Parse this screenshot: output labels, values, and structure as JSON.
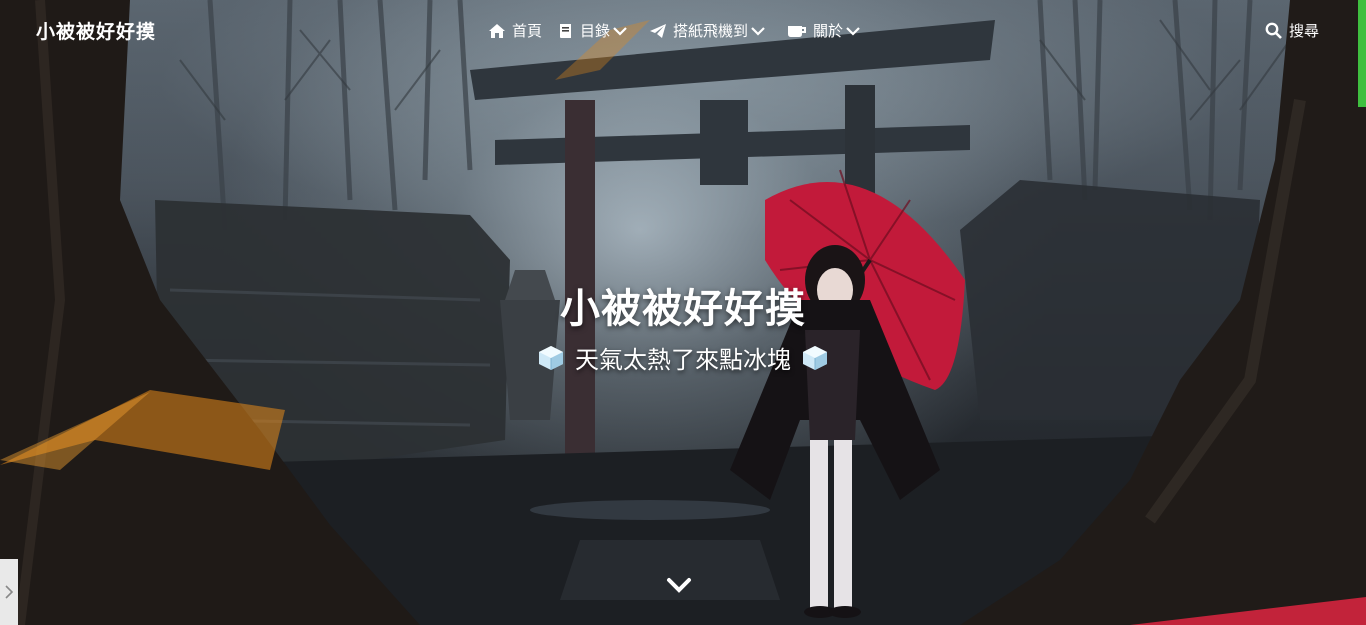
{
  "nav": {
    "brand": "小被被好好摸",
    "items": [
      {
        "label": "首頁",
        "icon": "home-icon",
        "has_dropdown": false
      },
      {
        "label": "目錄",
        "icon": "book-icon",
        "has_dropdown": true
      },
      {
        "label": "搭紙飛機到",
        "icon": "paper-plane-icon",
        "has_dropdown": true
      },
      {
        "label": "關於",
        "icon": "coffee-icon",
        "has_dropdown": true
      }
    ],
    "search_label": "搜尋"
  },
  "hero": {
    "title": "小被被好好摸",
    "subtitle": "天氣太熱了來點冰塊",
    "subtitle_icon": "ice-cube-icon"
  },
  "colors": {
    "accent_green": "#3fbf3f",
    "umbrella_red": "#c21a3a",
    "text": "#ffffff"
  }
}
